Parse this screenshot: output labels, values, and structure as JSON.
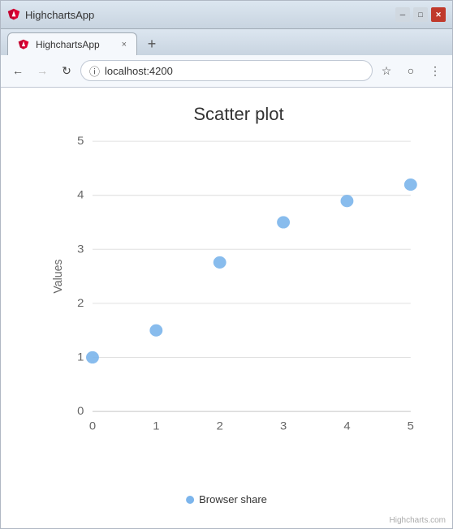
{
  "window": {
    "title": "HighchartsApp",
    "tab_close": "×",
    "tab_new": "+",
    "minimize": "─",
    "maximize": "□",
    "close": "✕"
  },
  "browser": {
    "url": "localhost:4200",
    "back": "←",
    "forward": "→",
    "reload": "↻",
    "star": "☆",
    "account": "○",
    "menu": "⋮",
    "info": "ⓘ"
  },
  "chart": {
    "title": "Scatter plot",
    "y_axis_label": "Values",
    "x_axis_ticks": [
      "0",
      "1",
      "2",
      "3",
      "4",
      "5"
    ],
    "y_axis_ticks": [
      "0",
      "1",
      "2",
      "3",
      "4",
      "5"
    ],
    "legend_label": "Browser share",
    "credit": "Highcharts.com",
    "points": [
      {
        "x": 0,
        "y": 1
      },
      {
        "x": 1,
        "y": 1.5
      },
      {
        "x": 2,
        "y": 2.75
      },
      {
        "x": 3,
        "y": 3.5
      },
      {
        "x": 4,
        "y": 3.9
      },
      {
        "x": 5,
        "y": 4.2
      }
    ]
  }
}
